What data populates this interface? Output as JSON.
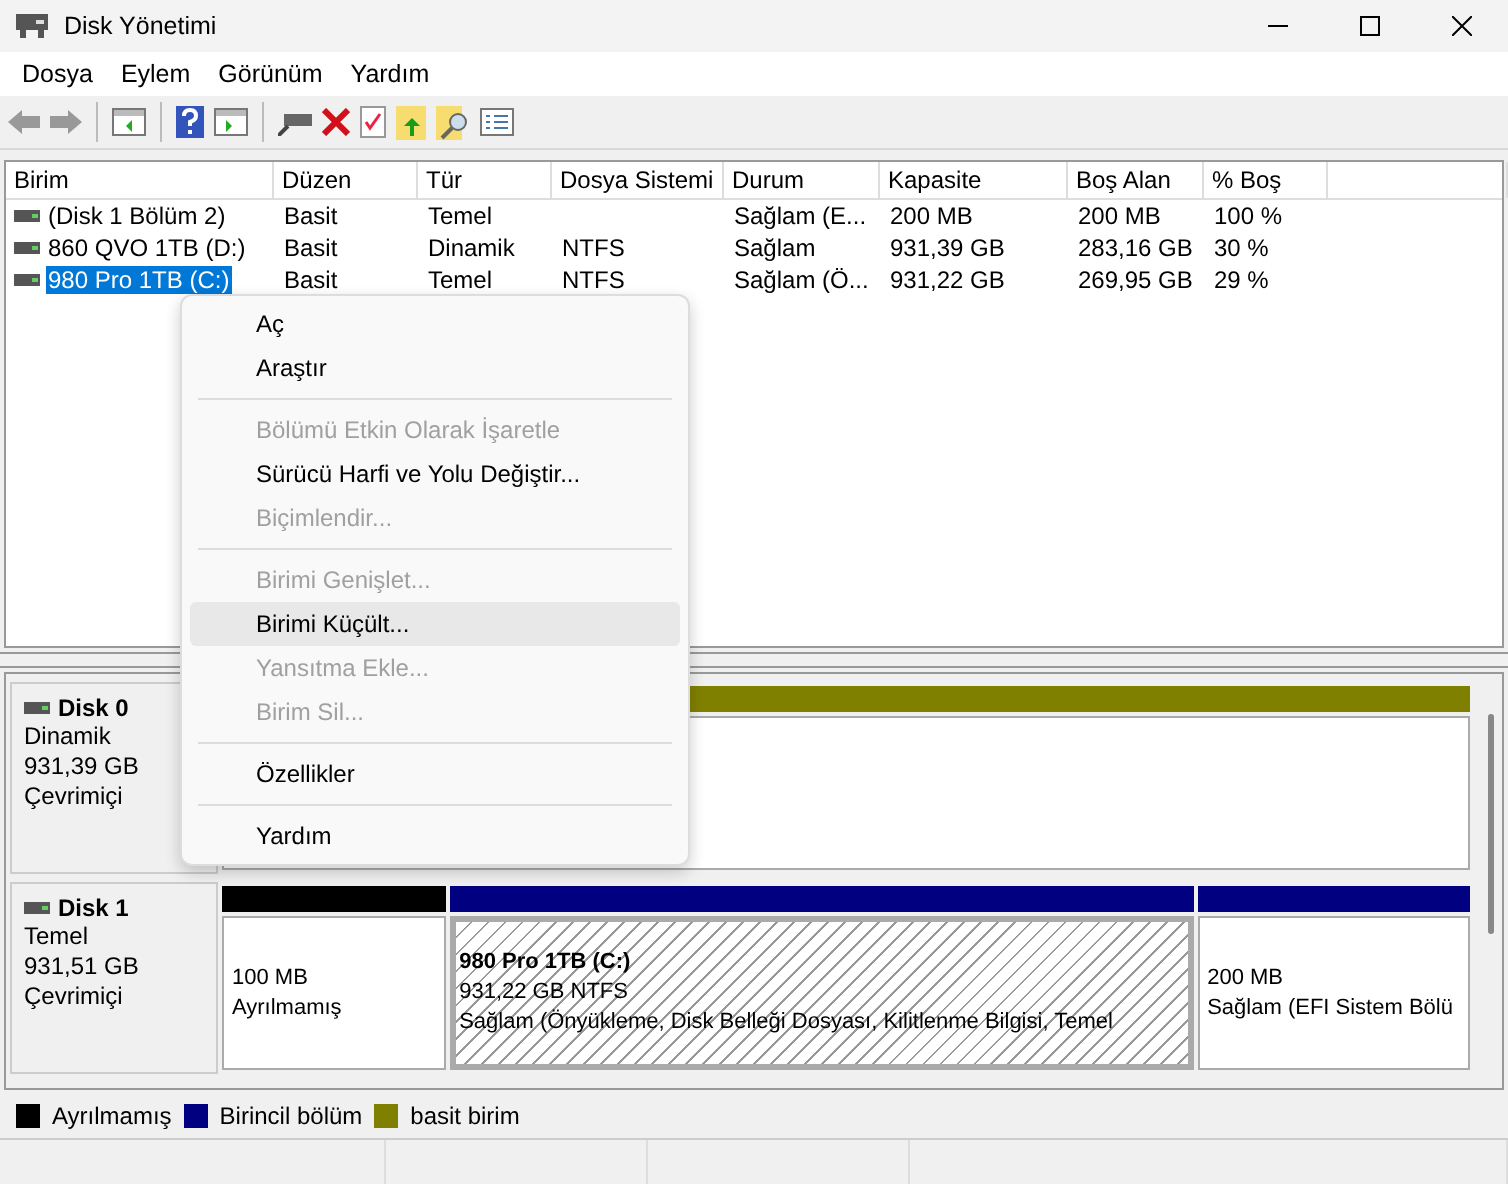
{
  "window": {
    "title": "Disk Yönetimi"
  },
  "menu_bar": [
    "Dosya",
    "Eylem",
    "Görünüm",
    "Yardım"
  ],
  "table": {
    "columns": [
      "Birim",
      "Düzen",
      "Tür",
      "Dosya Sistemi",
      "Durum",
      "Kapasite",
      "Boş Alan",
      "% Boş"
    ],
    "rows": [
      {
        "cells": [
          "(Disk 1 Bölüm 2)",
          "Basit",
          "Temel",
          "",
          "Sağlam (E...",
          "200 MB",
          "200 MB",
          "100 %"
        ],
        "selected": false
      },
      {
        "cells": [
          "860 QVO 1TB (D:)",
          "Basit",
          "Dinamik",
          "NTFS",
          "Sağlam",
          "931,39 GB",
          "283,16 GB",
          "30 %"
        ],
        "selected": false
      },
      {
        "cells": [
          "980 Pro 1TB (C:)",
          "Basit",
          "Temel",
          "NTFS",
          "Sağlam (Ö...",
          "931,22 GB",
          "269,95 GB",
          "29 %"
        ],
        "selected": true
      }
    ]
  },
  "disks": [
    {
      "name": "Disk 0",
      "lines": [
        "Dinamik",
        "931,39 GB",
        "Çevrimiçi"
      ],
      "partitions": [
        {
          "color": "#808000",
          "selected": false
        }
      ]
    },
    {
      "name": "Disk 1",
      "lines": [
        "Temel",
        "931,51 GB",
        "Çevrimiçi"
      ],
      "partitions": [
        {
          "color": "#000000",
          "selected": false,
          "lines": [
            "100 MB",
            "Ayrılmamış"
          ]
        },
        {
          "color": "#000080",
          "selected": true,
          "title": "980 Pro 1TB  (C:)",
          "lines": [
            "931,22 GB NTFS",
            "Sağlam (Önyükleme, Disk Belleği Dosyası, Kilitlenme Bilgisi, Temel"
          ]
        },
        {
          "color": "#000080",
          "selected": false,
          "lines": [
            "200 MB",
            "Sağlam (EFI Sistem Bölü"
          ]
        }
      ]
    }
  ],
  "legend": [
    {
      "label": "Ayrılmamış",
      "color": "#000000"
    },
    {
      "label": "Birincil bölüm",
      "color": "#000080"
    },
    {
      "label": "basit birim",
      "color": "#808000"
    }
  ],
  "context_menu": [
    {
      "kind": "item",
      "label": "Aç",
      "disabled": false,
      "selected": false
    },
    {
      "kind": "item",
      "label": "Araştır",
      "disabled": false,
      "selected": false
    },
    {
      "kind": "separator"
    },
    {
      "kind": "item",
      "label": "Bölümü Etkin Olarak İşaretle",
      "disabled": true,
      "selected": false
    },
    {
      "kind": "item",
      "label": "Sürücü Harfi ve Yolu Değiştir...",
      "disabled": false,
      "selected": false
    },
    {
      "kind": "item",
      "label": "Biçimlendir...",
      "disabled": true,
      "selected": false
    },
    {
      "kind": "separator"
    },
    {
      "kind": "item",
      "label": "Birimi Genişlet...",
      "disabled": true,
      "selected": false
    },
    {
      "kind": "item",
      "label": "Birimi Küçült...",
      "disabled": false,
      "selected": true
    },
    {
      "kind": "item",
      "label": "Yansıtma Ekle...",
      "disabled": true,
      "selected": false
    },
    {
      "kind": "item",
      "label": "Birim Sil...",
      "disabled": true,
      "selected": false
    },
    {
      "kind": "separator"
    },
    {
      "kind": "item",
      "label": "Özellikler",
      "disabled": false,
      "selected": false
    },
    {
      "kind": "separator"
    },
    {
      "kind": "item",
      "label": "Yardım",
      "disabled": false,
      "selected": false
    }
  ]
}
